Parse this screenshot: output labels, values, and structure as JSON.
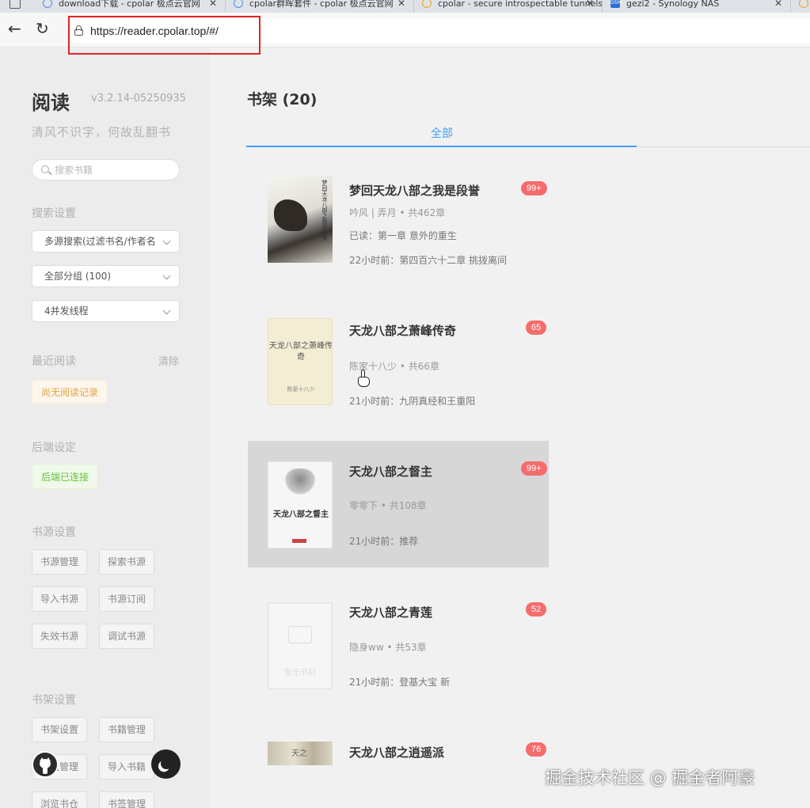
{
  "browser": {
    "tabs": [
      {
        "title": "download下载 - cpolar 极点云官网"
      },
      {
        "title": "cpolar群晖套件 - cpolar 极点云官网"
      },
      {
        "title": "cpolar - secure introspectable tunnels"
      },
      {
        "title": "gezi2 - Synology NAS"
      }
    ],
    "url": "https://reader.cpolar.top/#/"
  },
  "sidebar": {
    "title": "阅读",
    "version": "v3.2.14-05250935",
    "slogan": "清风不识字，何故乱翻书",
    "search_placeholder": "搜索书籍",
    "search_settings_label": "搜索设置",
    "select_source": "多源搜索(过滤书名/作者名)",
    "select_group": "全部分组 (100)",
    "select_threads": "4并发线程",
    "recent_label": "最近阅读",
    "clear_label": "清除",
    "no_history": "尚无阅读记录",
    "backend_label": "后端设定",
    "backend_status": "后端已连接",
    "source_settings_label": "书源设置",
    "source_buttons": [
      "书源管理",
      "探索书源",
      "导入书源",
      "书源订阅",
      "失效书源",
      "调试书源"
    ],
    "shelf_settings_label": "书架设置",
    "shelf_buttons": [
      "书架设置",
      "书籍管理",
      "分组管理",
      "导入书籍",
      "浏览书仓",
      "书签管理"
    ]
  },
  "main": {
    "title": "书架 (20)",
    "tab_all": "全部",
    "books": [
      {
        "title": "梦回天龙八部之我是段誉",
        "badge": "99+",
        "meta": "吟风 | 弄月 • 共462章",
        "read": "已读：第一章 意外的重生",
        "latest": "22小时前：第四百六十二章 挑拨离间",
        "cover_text": "梦回天龙八部之我是段誉"
      },
      {
        "title": "天龙八部之萧峰传奇",
        "badge": "65",
        "meta": "陈家十八少 • 共66章",
        "latest": "21小时前：九阴真经和王重阳",
        "cover_text": "天龙八部之萧峰传奇",
        "cover_author": "陈家十八少"
      },
      {
        "title": "天龙八部之督主",
        "badge": "99+",
        "meta": "零零下 • 共108章",
        "latest": "21小时前：推荐",
        "cover_text": "天龙八部之督主"
      },
      {
        "title": "天龙八部之青莲",
        "badge": "52",
        "meta": "隐身ww • 共53章",
        "latest": "21小时前：登基大宝 新",
        "cover_text": "暂无书封"
      },
      {
        "title": "天龙八部之逍遥派",
        "badge": "76",
        "cover_text": "天之"
      }
    ]
  },
  "watermark": "掘金技术社区 @ 掘金者阿豪"
}
